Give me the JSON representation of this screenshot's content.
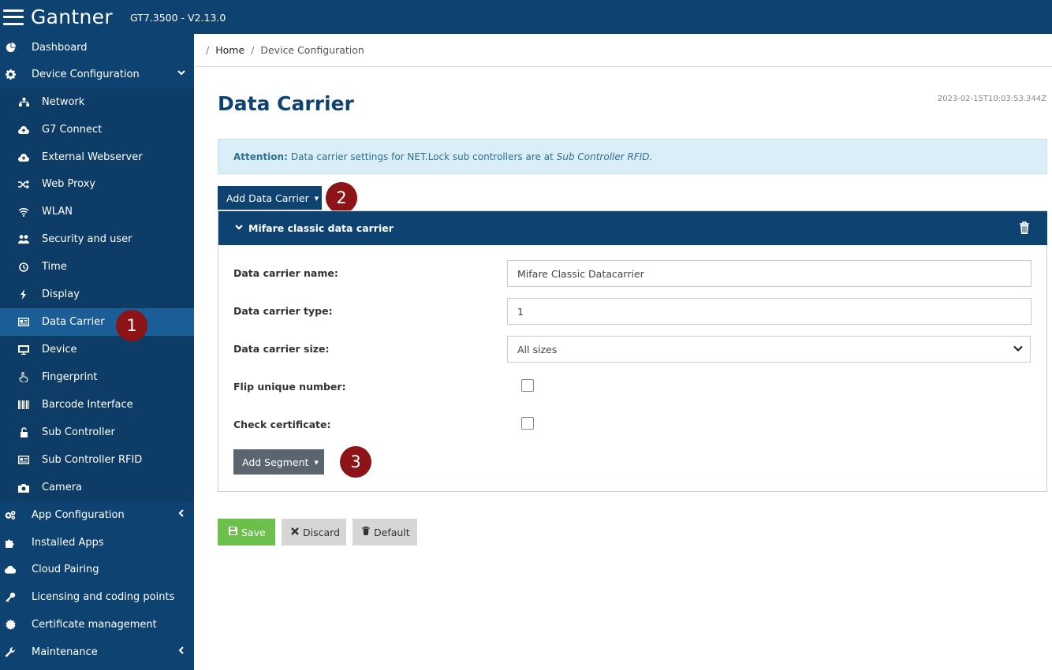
{
  "header": {
    "brand": "Gantner",
    "version": "GT7.3500 - V2.13.0"
  },
  "sidebar": {
    "items": [
      {
        "label": "Dashboard",
        "icon": "dashboard-icon"
      },
      {
        "label": "Device Configuration",
        "icon": "gear-icon",
        "expanded": true
      },
      {
        "label": "Network",
        "icon": "network-icon"
      },
      {
        "label": "G7 Connect",
        "icon": "cloud-upload-icon"
      },
      {
        "label": "External Webserver",
        "icon": "cloud-upload-icon"
      },
      {
        "label": "Web Proxy",
        "icon": "shuffle-icon"
      },
      {
        "label": "WLAN",
        "icon": "wifi-icon"
      },
      {
        "label": "Security and user",
        "icon": "users-icon"
      },
      {
        "label": "Time",
        "icon": "clock-icon"
      },
      {
        "label": "Display",
        "icon": "bolt-icon"
      },
      {
        "label": "Data Carrier",
        "icon": "id-card-icon",
        "active": true
      },
      {
        "label": "Device",
        "icon": "monitor-icon"
      },
      {
        "label": "Fingerprint",
        "icon": "hand-pointer-icon"
      },
      {
        "label": "Barcode Interface",
        "icon": "barcode-icon"
      },
      {
        "label": "Sub Controller",
        "icon": "unlock-icon"
      },
      {
        "label": "Sub Controller RFID",
        "icon": "id-card-icon"
      },
      {
        "label": "Camera",
        "icon": "camera-icon"
      },
      {
        "label": "App Configuration",
        "icon": "gears-icon"
      },
      {
        "label": "Installed Apps",
        "icon": "puzzle-icon"
      },
      {
        "label": "Cloud Pairing",
        "icon": "cloud-icon"
      },
      {
        "label": "Licensing and coding points",
        "icon": "key-icon"
      },
      {
        "label": "Certificate management",
        "icon": "certificate-icon"
      },
      {
        "label": "Maintenance",
        "icon": "wrench-icon"
      }
    ]
  },
  "breadcrumb": {
    "home": "Home",
    "current": "Device Configuration"
  },
  "page": {
    "title": "Data Carrier",
    "timestamp": "2023-02-15T10:03:53.344Z"
  },
  "alert": {
    "strong": "Attention:",
    "text": "Data carrier settings for NET.Lock sub controllers are at",
    "link_text": "Sub Controller RFID."
  },
  "toolbar": {
    "add_data_carrier": "Add Data Carrier",
    "add_segment": "Add Segment"
  },
  "markers": [
    "1",
    "2",
    "3"
  ],
  "carrier_panel": {
    "title": "Mifare classic data carrier",
    "fields": {
      "name_label": "Data carrier name:",
      "name_value": "Mifare Classic Datacarrier",
      "type_label": "Data carrier type:",
      "type_value": "1",
      "size_label": "Data carrier size:",
      "size_value": "All sizes",
      "flip_label": "Flip unique number:",
      "flip_checked": false,
      "cert_label": "Check certificate:",
      "cert_checked": false
    }
  },
  "actions": {
    "save": "Save",
    "discard": "Discard",
    "default": "Default"
  },
  "colors": {
    "primary": "#0e4371",
    "sidebar_active": "#1b5d96",
    "marker": "#8c1416",
    "save": "#6cbf4b",
    "alert_bg": "#d9eef7"
  }
}
